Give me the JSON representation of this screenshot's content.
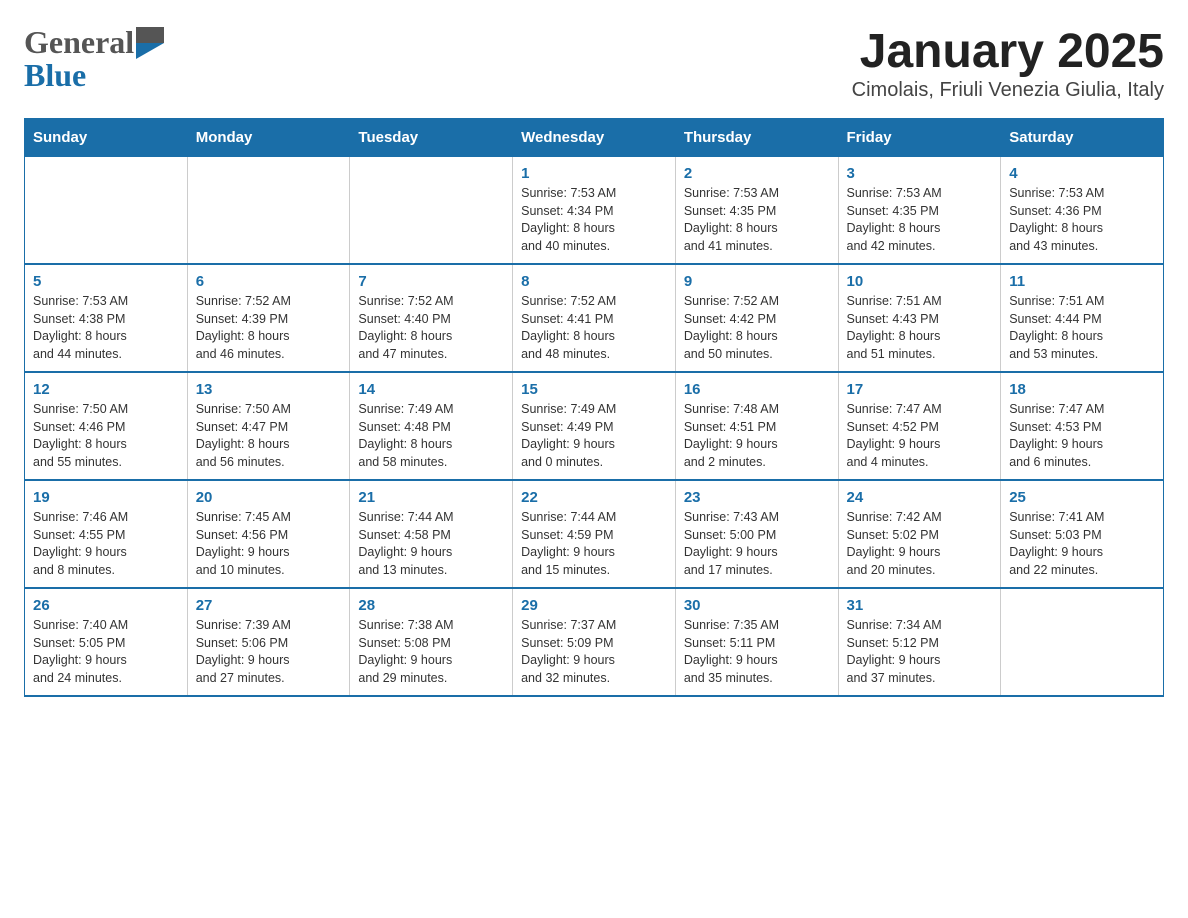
{
  "header": {
    "logo_general": "General",
    "logo_blue": "Blue",
    "title": "January 2025",
    "subtitle": "Cimolais, Friuli Venezia Giulia, Italy"
  },
  "days_of_week": [
    "Sunday",
    "Monday",
    "Tuesday",
    "Wednesday",
    "Thursday",
    "Friday",
    "Saturday"
  ],
  "weeks": [
    {
      "days": [
        {
          "number": "",
          "info": ""
        },
        {
          "number": "",
          "info": ""
        },
        {
          "number": "",
          "info": ""
        },
        {
          "number": "1",
          "info": "Sunrise: 7:53 AM\nSunset: 4:34 PM\nDaylight: 8 hours\nand 40 minutes."
        },
        {
          "number": "2",
          "info": "Sunrise: 7:53 AM\nSunset: 4:35 PM\nDaylight: 8 hours\nand 41 minutes."
        },
        {
          "number": "3",
          "info": "Sunrise: 7:53 AM\nSunset: 4:35 PM\nDaylight: 8 hours\nand 42 minutes."
        },
        {
          "number": "4",
          "info": "Sunrise: 7:53 AM\nSunset: 4:36 PM\nDaylight: 8 hours\nand 43 minutes."
        }
      ]
    },
    {
      "days": [
        {
          "number": "5",
          "info": "Sunrise: 7:53 AM\nSunset: 4:38 PM\nDaylight: 8 hours\nand 44 minutes."
        },
        {
          "number": "6",
          "info": "Sunrise: 7:52 AM\nSunset: 4:39 PM\nDaylight: 8 hours\nand 46 minutes."
        },
        {
          "number": "7",
          "info": "Sunrise: 7:52 AM\nSunset: 4:40 PM\nDaylight: 8 hours\nand 47 minutes."
        },
        {
          "number": "8",
          "info": "Sunrise: 7:52 AM\nSunset: 4:41 PM\nDaylight: 8 hours\nand 48 minutes."
        },
        {
          "number": "9",
          "info": "Sunrise: 7:52 AM\nSunset: 4:42 PM\nDaylight: 8 hours\nand 50 minutes."
        },
        {
          "number": "10",
          "info": "Sunrise: 7:51 AM\nSunset: 4:43 PM\nDaylight: 8 hours\nand 51 minutes."
        },
        {
          "number": "11",
          "info": "Sunrise: 7:51 AM\nSunset: 4:44 PM\nDaylight: 8 hours\nand 53 minutes."
        }
      ]
    },
    {
      "days": [
        {
          "number": "12",
          "info": "Sunrise: 7:50 AM\nSunset: 4:46 PM\nDaylight: 8 hours\nand 55 minutes."
        },
        {
          "number": "13",
          "info": "Sunrise: 7:50 AM\nSunset: 4:47 PM\nDaylight: 8 hours\nand 56 minutes."
        },
        {
          "number": "14",
          "info": "Sunrise: 7:49 AM\nSunset: 4:48 PM\nDaylight: 8 hours\nand 58 minutes."
        },
        {
          "number": "15",
          "info": "Sunrise: 7:49 AM\nSunset: 4:49 PM\nDaylight: 9 hours\nand 0 minutes."
        },
        {
          "number": "16",
          "info": "Sunrise: 7:48 AM\nSunset: 4:51 PM\nDaylight: 9 hours\nand 2 minutes."
        },
        {
          "number": "17",
          "info": "Sunrise: 7:47 AM\nSunset: 4:52 PM\nDaylight: 9 hours\nand 4 minutes."
        },
        {
          "number": "18",
          "info": "Sunrise: 7:47 AM\nSunset: 4:53 PM\nDaylight: 9 hours\nand 6 minutes."
        }
      ]
    },
    {
      "days": [
        {
          "number": "19",
          "info": "Sunrise: 7:46 AM\nSunset: 4:55 PM\nDaylight: 9 hours\nand 8 minutes."
        },
        {
          "number": "20",
          "info": "Sunrise: 7:45 AM\nSunset: 4:56 PM\nDaylight: 9 hours\nand 10 minutes."
        },
        {
          "number": "21",
          "info": "Sunrise: 7:44 AM\nSunset: 4:58 PM\nDaylight: 9 hours\nand 13 minutes."
        },
        {
          "number": "22",
          "info": "Sunrise: 7:44 AM\nSunset: 4:59 PM\nDaylight: 9 hours\nand 15 minutes."
        },
        {
          "number": "23",
          "info": "Sunrise: 7:43 AM\nSunset: 5:00 PM\nDaylight: 9 hours\nand 17 minutes."
        },
        {
          "number": "24",
          "info": "Sunrise: 7:42 AM\nSunset: 5:02 PM\nDaylight: 9 hours\nand 20 minutes."
        },
        {
          "number": "25",
          "info": "Sunrise: 7:41 AM\nSunset: 5:03 PM\nDaylight: 9 hours\nand 22 minutes."
        }
      ]
    },
    {
      "days": [
        {
          "number": "26",
          "info": "Sunrise: 7:40 AM\nSunset: 5:05 PM\nDaylight: 9 hours\nand 24 minutes."
        },
        {
          "number": "27",
          "info": "Sunrise: 7:39 AM\nSunset: 5:06 PM\nDaylight: 9 hours\nand 27 minutes."
        },
        {
          "number": "28",
          "info": "Sunrise: 7:38 AM\nSunset: 5:08 PM\nDaylight: 9 hours\nand 29 minutes."
        },
        {
          "number": "29",
          "info": "Sunrise: 7:37 AM\nSunset: 5:09 PM\nDaylight: 9 hours\nand 32 minutes."
        },
        {
          "number": "30",
          "info": "Sunrise: 7:35 AM\nSunset: 5:11 PM\nDaylight: 9 hours\nand 35 minutes."
        },
        {
          "number": "31",
          "info": "Sunrise: 7:34 AM\nSunset: 5:12 PM\nDaylight: 9 hours\nand 37 minutes."
        },
        {
          "number": "",
          "info": ""
        }
      ]
    }
  ]
}
